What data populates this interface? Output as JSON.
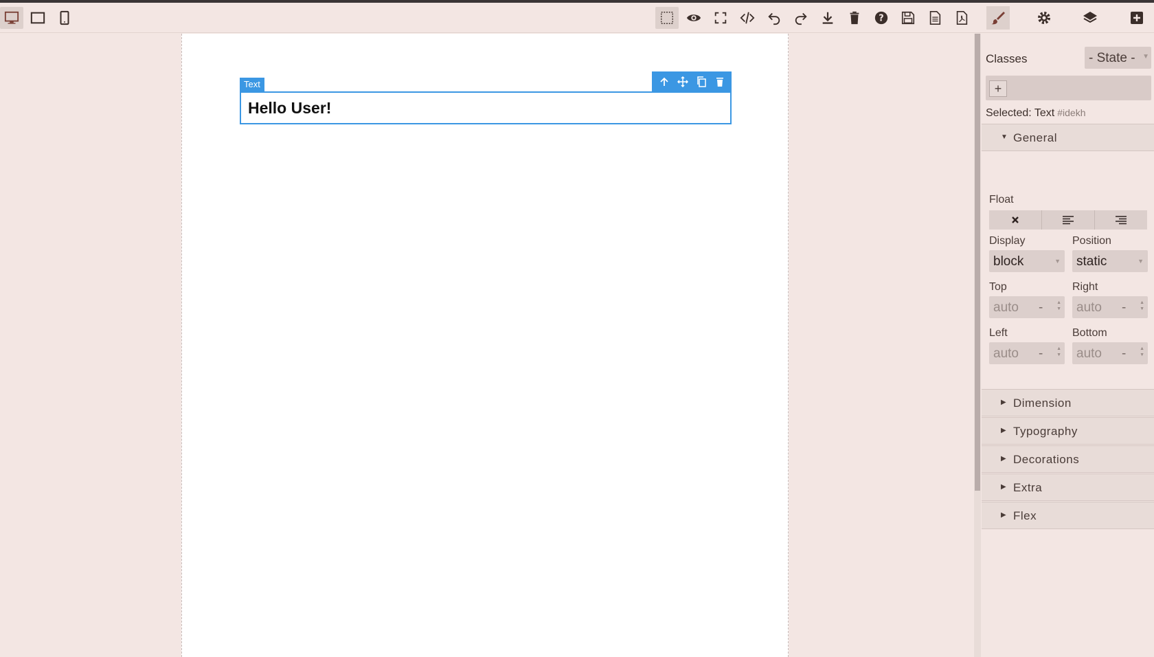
{
  "devices": [
    {
      "name": "desktop",
      "icon": "desktop-icon",
      "active": true
    },
    {
      "name": "tablet",
      "icon": "tablet-icon",
      "active": false
    },
    {
      "name": "mobile",
      "icon": "mobile-icon",
      "active": false
    }
  ],
  "toolbar": {
    "buttons": [
      "sw-visibility-icon",
      "preview-icon",
      "fullscreen-icon",
      "code-icon",
      "undo-icon",
      "redo-icon",
      "export-icon",
      "clear-canvas-icon",
      "help-icon",
      "save-icon",
      "import-icon",
      "pdf-icon"
    ]
  },
  "panel_tabs": [
    "style-manager-icon",
    "settings-icon",
    "layer-manager-icon",
    "blocks-icon"
  ],
  "canvas": {
    "badge_label": "Text",
    "text_content": "Hello User!",
    "component_actions": [
      "select-parent-icon",
      "move-icon",
      "clone-icon",
      "delete-icon"
    ]
  },
  "selector": {
    "classes_label": "Classes",
    "state_value": "- State -",
    "add_label": "+",
    "selected_label": "Selected: Text",
    "selected_id": "#idekh"
  },
  "sections": {
    "general": "General",
    "dimension": "Dimension",
    "typography": "Typography",
    "decorations": "Decorations",
    "extra": "Extra",
    "flex": "Flex"
  },
  "general": {
    "float_label": "Float",
    "float_options": [
      "none",
      "left",
      "right"
    ],
    "display_label": "Display",
    "display_value": "block",
    "position_label": "Position",
    "position_value": "static",
    "top_label": "Top",
    "top_value": "auto",
    "right_label": "Right",
    "right_value": "auto",
    "left_label": "Left",
    "left_value": "auto",
    "bottom_label": "Bottom",
    "bottom_value": "auto",
    "unit_value": "-"
  },
  "colors": {
    "accent": "#3b97e3",
    "background": "#f3e6e3",
    "text": "#3b2e2a"
  }
}
